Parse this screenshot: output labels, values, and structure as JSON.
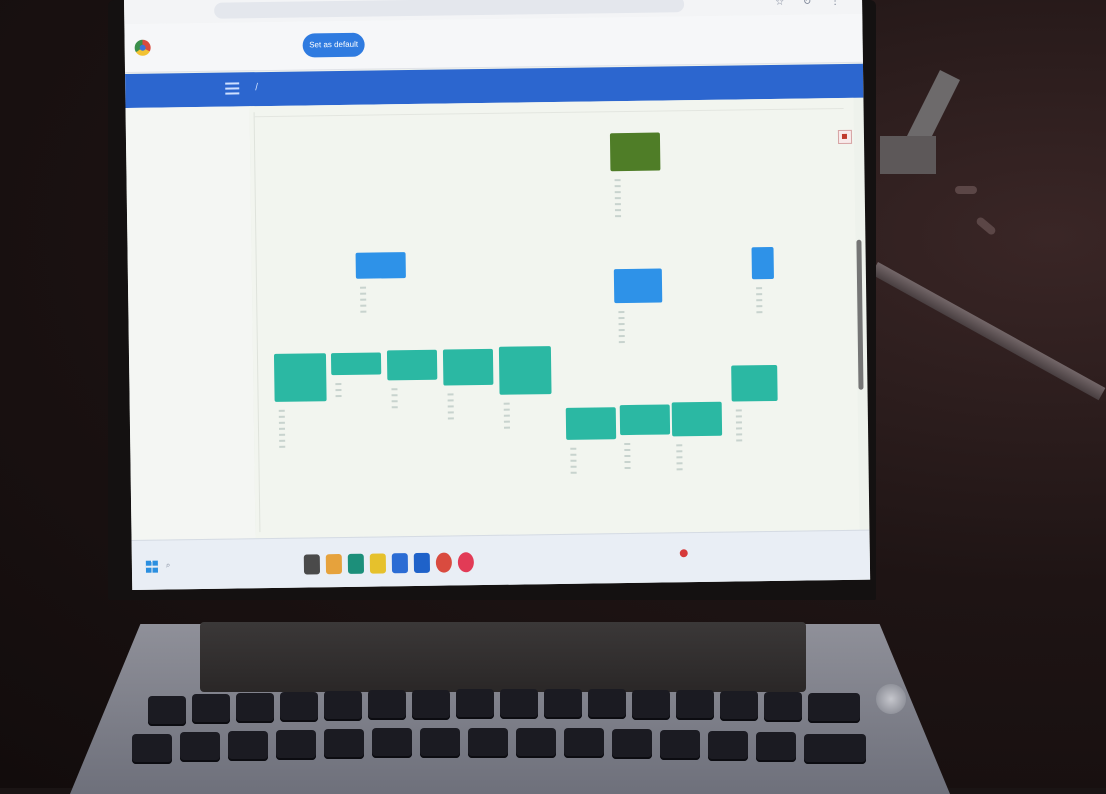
{
  "browser": {
    "url": "",
    "icons": "☆ ↻ ⋮"
  },
  "infobar": {
    "message": "",
    "button": "Set as default"
  },
  "app": {
    "brand": "",
    "nav": [
      "",
      "",
      "",
      ""
    ]
  },
  "sidebar": {
    "title": "",
    "subtitle": "",
    "items": [
      "",
      "",
      "",
      "",
      "",
      "",
      "",
      "",
      ""
    ]
  },
  "diagram": {
    "colors": {
      "teal": "#2bb8a3",
      "blue": "#2e92e8",
      "green": "#4f7d27"
    },
    "nodes": [
      {
        "color": "green"
      },
      {
        "color": "blue"
      },
      {
        "color": "blue"
      },
      {
        "color": "blue"
      },
      {
        "color": "teal"
      },
      {
        "color": "teal"
      },
      {
        "color": "teal"
      },
      {
        "color": "teal"
      },
      {
        "color": "teal"
      },
      {
        "color": "teal"
      },
      {
        "color": "teal"
      },
      {
        "color": "teal"
      },
      {
        "color": "teal"
      }
    ]
  },
  "taskbar": {
    "search": "",
    "apps": [
      "file-icon",
      "files-icon",
      "edge-icon",
      "folder-icon",
      "store-icon",
      "word-icon",
      "chrome-icon",
      "opera-icon"
    ],
    "app_colors": [
      "#4a4a4a",
      "#e6a23c",
      "#1c8f7a",
      "#e6c12c",
      "#2b6cd4",
      "#1f62c9",
      "#d94b3f",
      "#e23b56"
    ],
    "tray": [
      "",
      ""
    ]
  }
}
